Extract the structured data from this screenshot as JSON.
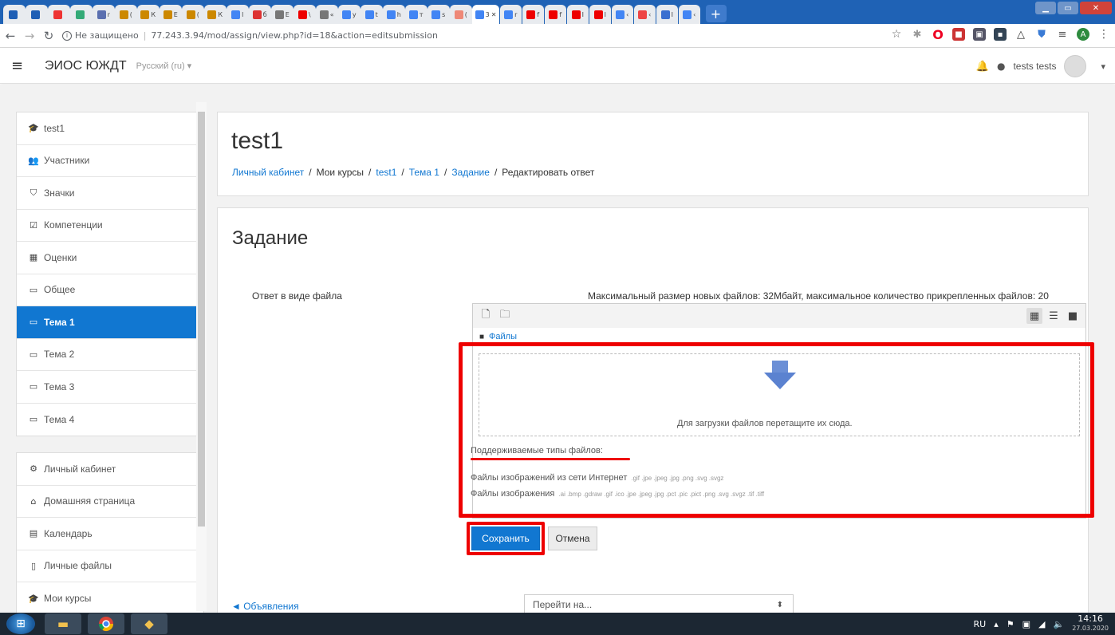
{
  "browser": {
    "tabs": [
      {
        "label": "",
        "color": "#1f5fb5",
        "icon": "moodle-icon"
      },
      {
        "label": "",
        "color": "#1f5fb5",
        "icon": "moodle-icon"
      },
      {
        "label": "",
        "color": "#e33",
        "icon": "mail-icon"
      },
      {
        "label": "",
        "color": "#3a7",
        "icon": "site-icon"
      },
      {
        "label": "r",
        "color": "#5a6fb0",
        "icon": "site-icon"
      },
      {
        "label": "(",
        "color": "#c80",
        "icon": "site-icon"
      },
      {
        "label": "К",
        "color": "#c80",
        "icon": "site-icon"
      },
      {
        "label": "Е",
        "color": "#c80",
        "icon": "site-icon"
      },
      {
        "label": "(",
        "color": "#c80",
        "icon": "site-icon"
      },
      {
        "label": "К",
        "color": "#c80",
        "icon": "site-icon"
      },
      {
        "label": "l",
        "color": "#4285f4",
        "icon": "google-icon"
      },
      {
        "label": "б",
        "color": "#d33",
        "icon": "site-icon"
      },
      {
        "label": "Е",
        "color": "#777",
        "icon": "site-icon"
      },
      {
        "label": "\\",
        "color": "#e00",
        "icon": "youtube-icon"
      },
      {
        "label": "«",
        "color": "#777",
        "icon": "site-icon"
      },
      {
        "label": "у",
        "color": "#4285f4",
        "icon": "google-icon"
      },
      {
        "label": "t",
        "color": "#4285f4",
        "icon": "google-icon"
      },
      {
        "label": "h",
        "color": "#4285f4",
        "icon": "google-icon"
      },
      {
        "label": "т",
        "color": "#4285f4",
        "icon": "google-icon"
      },
      {
        "label": "s",
        "color": "#4285f4",
        "icon": "google-icon"
      },
      {
        "label": "(",
        "color": "#e87",
        "icon": "site-icon"
      },
      {
        "label": "3",
        "color": "#4285f4",
        "icon": "google-icon",
        "active": true
      },
      {
        "label": "r",
        "color": "#4285f4",
        "icon": "google-icon"
      },
      {
        "label": "f",
        "color": "#e00",
        "icon": "youtube-icon"
      },
      {
        "label": "f",
        "color": "#e00",
        "icon": "youtube-icon"
      },
      {
        "label": "I",
        "color": "#e00",
        "icon": "youtube-icon"
      },
      {
        "label": "I",
        "color": "#e00",
        "icon": "youtube-icon"
      },
      {
        "label": "‹",
        "color": "#4285f4",
        "icon": "google-icon"
      },
      {
        "label": "‹",
        "color": "#e44",
        "icon": "site-icon"
      },
      {
        "label": "I",
        "color": "#3a6fd0",
        "icon": "site-icon"
      },
      {
        "label": "‹",
        "color": "#4285f4",
        "icon": "google-icon"
      }
    ],
    "new_tab": "+",
    "url_security": "Не защищено",
    "url": "77.243.3.94/mod/assign/view.php?id=18&action=editsubmission"
  },
  "header": {
    "menu_icon": "≡",
    "site_name": "ЭИОС ЮЖДТ",
    "language": "Русский (ru) ▾",
    "user_name": "tests tests",
    "user_menu_arrow": "▾"
  },
  "nav_course": [
    {
      "label": "test1",
      "icon": "graduation-cap-icon",
      "glyph": "🎓"
    },
    {
      "label": "Участники",
      "icon": "users-icon",
      "glyph": "👥"
    },
    {
      "label": "Значки",
      "icon": "shield-icon",
      "glyph": "⛉"
    },
    {
      "label": "Компетенции",
      "icon": "checkbox-icon",
      "glyph": "☑"
    },
    {
      "label": "Оценки",
      "icon": "table-icon",
      "glyph": "▦"
    },
    {
      "label": "Общее",
      "icon": "folder-icon",
      "glyph": "▭"
    },
    {
      "label": "Тема 1",
      "icon": "folder-icon",
      "glyph": "▭",
      "active": true
    },
    {
      "label": "Тема 2",
      "icon": "folder-icon",
      "glyph": "▭"
    },
    {
      "label": "Тема 3",
      "icon": "folder-icon",
      "glyph": "▭"
    },
    {
      "label": "Тема 4",
      "icon": "folder-icon",
      "glyph": "▭"
    }
  ],
  "nav_site": [
    {
      "label": "Личный кабинет",
      "icon": "dashboard-icon",
      "glyph": "⚙"
    },
    {
      "label": "Домашняя страница",
      "icon": "home-icon",
      "glyph": "⌂"
    },
    {
      "label": "Календарь",
      "icon": "calendar-icon",
      "glyph": "▤"
    },
    {
      "label": "Личные файлы",
      "icon": "file-icon",
      "glyph": "▯"
    },
    {
      "label": "Мои курсы",
      "icon": "graduation-cap-icon",
      "glyph": "🎓"
    }
  ],
  "page": {
    "title": "test1",
    "breadcrumb": [
      {
        "label": "Личный кабинет",
        "link": true
      },
      {
        "label": "Мои курсы",
        "link": false
      },
      {
        "label": "test1",
        "link": true
      },
      {
        "label": "Тема 1",
        "link": true
      },
      {
        "label": "Задание",
        "link": true
      },
      {
        "label": "Редактировать ответ",
        "link": false
      }
    ],
    "breadcrumb_sep": "/"
  },
  "assignment": {
    "heading": "Задание",
    "file_label": "Ответ в виде файла",
    "max_info": "Максимальный размер новых файлов: 32Мбайт, максимальное количество прикрепленных файлов: 20",
    "path_label": "Файлы",
    "drop_text": "Для загрузки файлов перетащите их сюда.",
    "supported_types": "Поддерживаемые типы файлов:",
    "type_groups": [
      {
        "name": "Файлы изображений из сети Интернет",
        "exts": ".gif .jpe .jpeg .jpg .png .svg .svgz"
      },
      {
        "name": "Файлы изображения",
        "exts": ".ai .bmp .gdraw .gif .ico .jpe .jpeg .jpg .pct .pic .pict .png .svg .svgz .tif .tiff"
      }
    ],
    "save_label": "Сохранить",
    "cancel_label": "Отмена"
  },
  "footer": {
    "prev_link": "◄ Объявления",
    "jump_placeholder": "Перейти на...",
    "jump_arrow": "⬍"
  },
  "taskbar": {
    "lang": "RU",
    "time": "14:16",
    "date": "27.03.2020"
  },
  "colors": {
    "accent": "#1177d1",
    "highlight_red": "#e00000",
    "tabstrip": "#1f62b5",
    "taskbar": "#1c2733"
  }
}
